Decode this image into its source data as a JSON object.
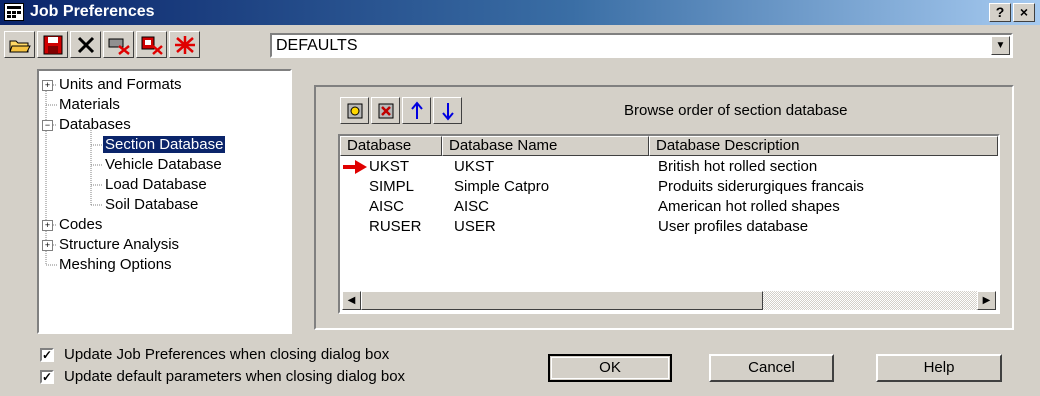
{
  "window": {
    "title": "Job Preferences",
    "help_btn": "?",
    "close_btn": "×"
  },
  "toolbar": {
    "tools": [
      "open-folder-icon",
      "save-icon",
      "delete-icon",
      "reset-icon",
      "copy-icon",
      "clear-icon"
    ]
  },
  "preset": {
    "value": "DEFAULTS"
  },
  "tree": {
    "items": [
      {
        "label": "Units and Formats",
        "expander": "+"
      },
      {
        "label": "Materials"
      },
      {
        "label": "Databases",
        "expander": "−"
      },
      {
        "label": "Section Database",
        "selected": true
      },
      {
        "label": "Vehicle Database"
      },
      {
        "label": "Load Database"
      },
      {
        "label": "Soil Database"
      },
      {
        "label": "Codes",
        "expander": "+"
      },
      {
        "label": "Structure Analysis",
        "expander": "+"
      },
      {
        "label": "Meshing Options"
      }
    ]
  },
  "browse": {
    "title": "Browse order of section database",
    "buttons": [
      "add-icon",
      "remove-icon",
      "move-up-icon",
      "move-down-icon"
    ],
    "columns": [
      "Database",
      "Database Name",
      "Database Description"
    ],
    "rows": [
      {
        "db": "UKST",
        "name": "UKST",
        "desc": "British hot rolled section",
        "current": true
      },
      {
        "db": "SIMPL",
        "name": "Simple Catpro",
        "desc": "Produits siderurgiques francais"
      },
      {
        "db": "AISC",
        "name": "AISC",
        "desc": "American hot rolled shapes"
      },
      {
        "db": "RUSER",
        "name": "USER",
        "desc": "User profiles database"
      }
    ]
  },
  "options": {
    "update_job": {
      "label": "Update Job Preferences when closing dialog box",
      "checked": true
    },
    "update_default": {
      "label": "Update default parameters when closing dialog box",
      "checked": true
    }
  },
  "actions": {
    "ok": "OK",
    "cancel": "Cancel",
    "help": "Help"
  },
  "colors": {
    "title_start": "#0a246a",
    "title_end": "#a6caf0",
    "face": "#d4d0c8",
    "selection": "#0a246a",
    "arrow": "#e00000"
  }
}
